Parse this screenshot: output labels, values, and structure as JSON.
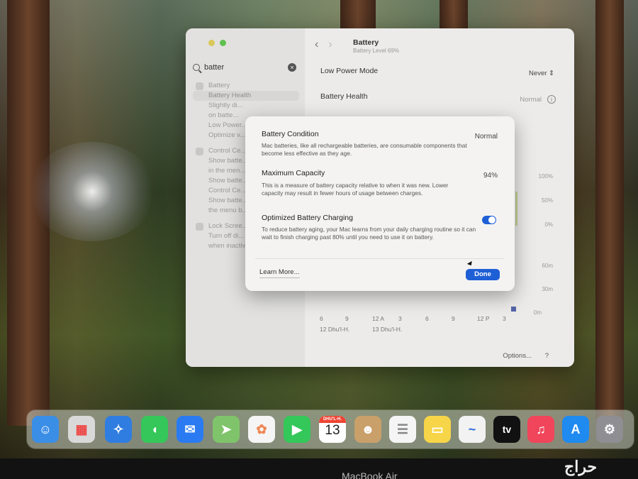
{
  "search": {
    "query": "batter"
  },
  "sidebar": {
    "items": [
      {
        "label": "Battery",
        "selected": false,
        "header": true
      },
      {
        "label": "Battery Health",
        "selected": true,
        "header": false
      },
      {
        "label": "Slightly di...",
        "selected": false,
        "header": false
      },
      {
        "label": "on batte...",
        "selected": false,
        "header": false
      },
      {
        "label": "Low Power...",
        "selected": false,
        "header": false
      },
      {
        "label": "Optimize v...",
        "selected": false,
        "header": false
      },
      {
        "label": "Control Ce...",
        "selected": false,
        "header": true
      },
      {
        "label": "Show batte...",
        "selected": false,
        "header": false
      },
      {
        "label": "in the men...",
        "selected": false,
        "header": false
      },
      {
        "label": "Show batte...",
        "selected": false,
        "header": false
      },
      {
        "label": "Control Ce...",
        "selected": false,
        "header": false
      },
      {
        "label": "Show batte...",
        "selected": false,
        "header": false
      },
      {
        "label": "the menu b...",
        "selected": false,
        "header": false
      },
      {
        "label": "Lock Scree...",
        "selected": false,
        "header": true
      },
      {
        "label": "Turn off di...",
        "selected": false,
        "header": false
      },
      {
        "label": "when inactive",
        "selected": false,
        "header": false
      }
    ]
  },
  "header": {
    "title": "Battery",
    "subtitle": "Battery Level 69%"
  },
  "settings": {
    "low_power_label": "Low Power Mode",
    "low_power_value": "Never",
    "health_label": "Battery Health",
    "health_value": "Normal",
    "y_pct": [
      "100%",
      "50%",
      "0%"
    ],
    "y_time": [
      "60m",
      "30m",
      "0m"
    ],
    "x_ticks": [
      "6",
      "9",
      "12 A",
      "3",
      "6",
      "9",
      "12 P",
      "3"
    ],
    "x_dates": [
      "12 Dhu'l-H.",
      "13 Dhu'l-H."
    ],
    "options_label": "Options...",
    "help_label": "?"
  },
  "modal": {
    "condition_title": "Battery Condition",
    "condition_desc": "Mac batteries, like all rechargeable batteries, are consumable components that become less effective as they age.",
    "condition_value": "Normal",
    "capacity_title": "Maximum Capacity",
    "capacity_desc": "This is a measure of battery capacity relative to when it was new. Lower capacity may result in fewer hours of usage between charges.",
    "capacity_value": "94%",
    "optimized_title": "Optimized Battery Charging",
    "optimized_desc": "To reduce battery aging, your Mac learns from your daily charging routine so it can wait to finish charging past 80% until you need to use it on battery.",
    "optimized_on": true,
    "learn_more": "Learn More...",
    "done": "Done"
  },
  "dock": {
    "apps": [
      {
        "name": "finder",
        "icon": "finder-icon",
        "color": "#3a8ee6"
      },
      {
        "name": "launchpad",
        "icon": "launchpad-icon",
        "color": "#d9d9d9"
      },
      {
        "name": "safari",
        "icon": "safari-icon",
        "color": "#2f7de0"
      },
      {
        "name": "messages",
        "icon": "messages-icon",
        "color": "#35c759"
      },
      {
        "name": "mail",
        "icon": "mail-icon",
        "color": "#2a7bf2"
      },
      {
        "name": "maps",
        "icon": "maps-icon",
        "color": "#7fc46a"
      },
      {
        "name": "photos",
        "icon": "photos-icon",
        "color": "#f5f5f5"
      },
      {
        "name": "facetime",
        "icon": "facetime-icon",
        "color": "#34c759"
      },
      {
        "name": "calendar",
        "icon": "calendar-icon",
        "color": "#ffffff",
        "month": "DHU'L-H.",
        "day": "13"
      },
      {
        "name": "contacts",
        "icon": "contacts-icon",
        "color": "#c9a06a"
      },
      {
        "name": "reminders",
        "icon": "reminders-icon",
        "color": "#f5f5f5"
      },
      {
        "name": "notes",
        "icon": "notes-icon",
        "color": "#f7d548"
      },
      {
        "name": "freeform",
        "icon": "freeform-icon",
        "color": "#f2f2f2"
      },
      {
        "name": "tv",
        "icon": "tv-icon",
        "color": "#111111",
        "label": "tv"
      },
      {
        "name": "music",
        "icon": "music-icon",
        "color": "#f0455a"
      },
      {
        "name": "app-store",
        "icon": "app-store-icon",
        "color": "#1f8af0"
      },
      {
        "name": "system-settings",
        "icon": "system-settings-icon",
        "color": "#8e8e93"
      }
    ]
  },
  "device": {
    "label": "MacBook Air"
  },
  "watermark": "حراج"
}
